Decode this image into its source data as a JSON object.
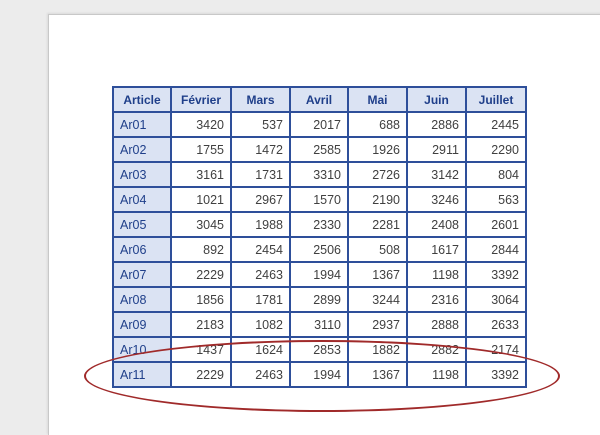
{
  "table": {
    "headers": [
      "Article",
      "Février",
      "Mars",
      "Avril",
      "Mai",
      "Juin",
      "Juillet"
    ],
    "rows": [
      [
        "Ar01",
        "3420",
        "537",
        "2017",
        "688",
        "2886",
        "2445"
      ],
      [
        "Ar02",
        "1755",
        "1472",
        "2585",
        "1926",
        "2911",
        "2290"
      ],
      [
        "Ar03",
        "3161",
        "1731",
        "3310",
        "2726",
        "3142",
        "804"
      ],
      [
        "Ar04",
        "1021",
        "2967",
        "1570",
        "2190",
        "3246",
        "563"
      ],
      [
        "Ar05",
        "3045",
        "1988",
        "2330",
        "2281",
        "2408",
        "2601"
      ],
      [
        "Ar06",
        "892",
        "2454",
        "2506",
        "508",
        "1617",
        "2844"
      ],
      [
        "Ar07",
        "2229",
        "2463",
        "1994",
        "1367",
        "1198",
        "3392"
      ],
      [
        "Ar08",
        "1856",
        "1781",
        "2899",
        "3244",
        "2316",
        "3064"
      ],
      [
        "Ar09",
        "2183",
        "1082",
        "3110",
        "2937",
        "2888",
        "2633"
      ],
      [
        "Ar10",
        "1437",
        "1624",
        "2853",
        "1882",
        "2882",
        "2174"
      ],
      [
        "Ar11",
        "2229",
        "2463",
        "1994",
        "1367",
        "1198",
        "3392"
      ]
    ]
  },
  "colors": {
    "border": "#2e4f9a",
    "header_bg": "#dbe3f3",
    "header_text": "#1f3f8a",
    "highlight": "#a02a2a"
  }
}
